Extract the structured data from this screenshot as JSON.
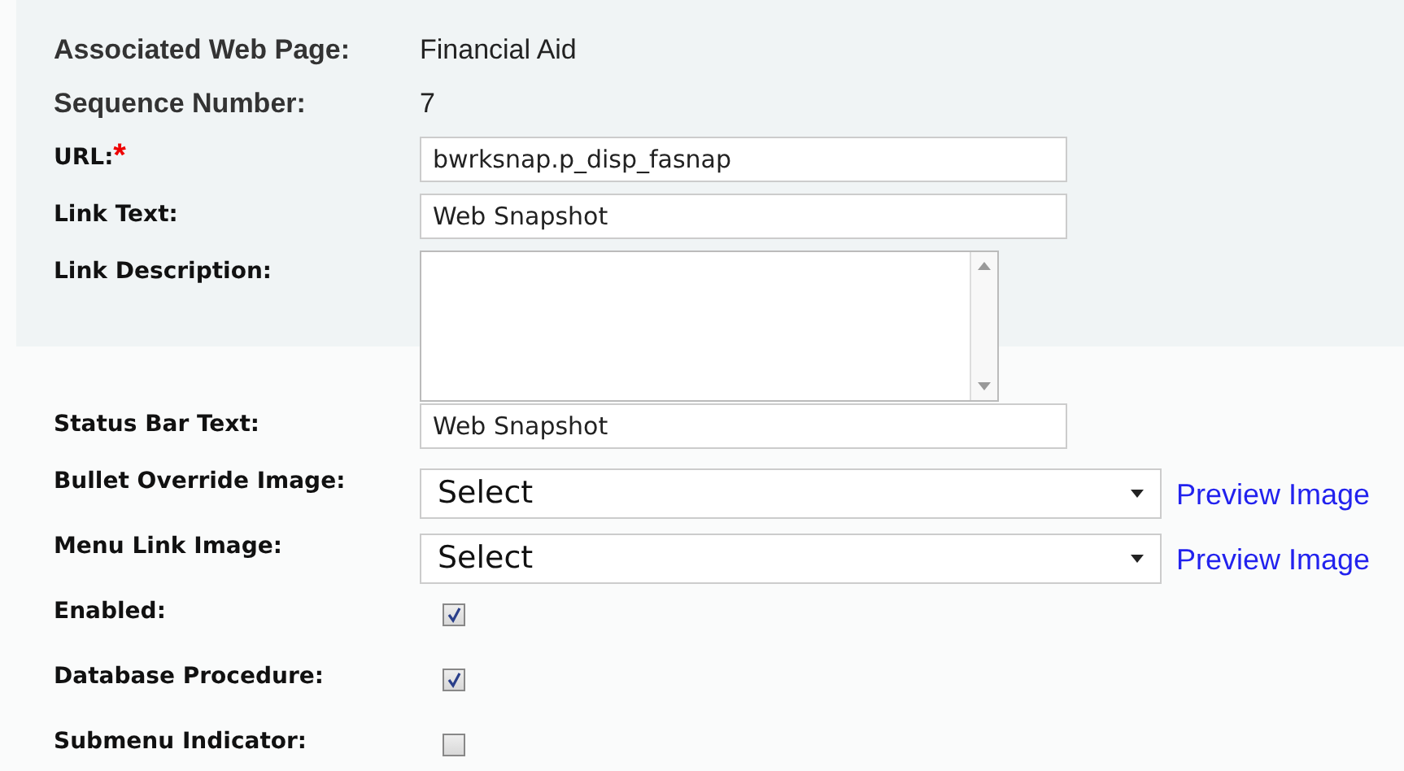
{
  "info": [
    {
      "label": "Associated Web Page:",
      "value": "Financial Aid"
    },
    {
      "label": "Sequence Number:",
      "value": "7"
    }
  ],
  "fields": [
    {
      "kind": "text",
      "label": "URL:",
      "required_mark": "*",
      "value": "bwrksnap.p_disp_fasnap"
    },
    {
      "kind": "text",
      "label": "Link Text:",
      "value": "Web Snapshot"
    },
    {
      "kind": "textarea",
      "label": "Link Description:"
    },
    {
      "kind": "text",
      "label": "Status Bar Text:",
      "value": "Web Snapshot"
    },
    {
      "kind": "select",
      "label": "Bullet Override Image:",
      "value": "Select",
      "link": "Preview Image"
    },
    {
      "kind": "select",
      "label": "Menu Link Image:",
      "value": "Select",
      "link": "Preview Image"
    },
    {
      "kind": "checkbox",
      "label": "Enabled:",
      "checked": true
    },
    {
      "kind": "checkbox",
      "label": "Database Procedure:",
      "checked": true
    },
    {
      "kind": "checkbox",
      "label": "Submenu Indicator:",
      "checked": false
    }
  ]
}
